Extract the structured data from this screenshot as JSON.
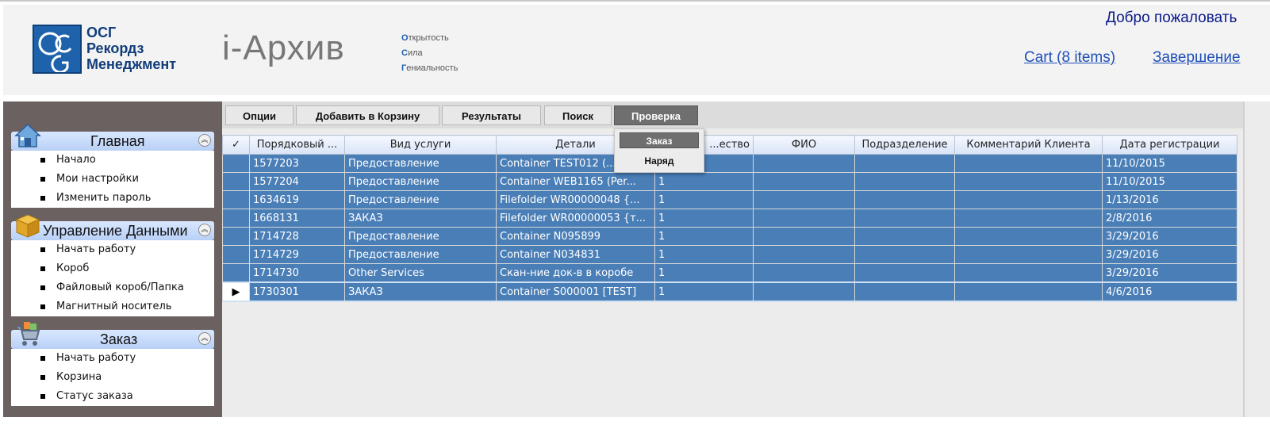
{
  "header": {
    "logo_initials": "OSG",
    "brand_lines": [
      "ОСГ",
      "Рекордз",
      "Менеджмент"
    ],
    "app_title": "i-Архив",
    "motto": [
      {
        "first": "О",
        "rest": "ткрытость"
      },
      {
        "first": "С",
        "rest": "ила"
      },
      {
        "first": "Г",
        "rest": "ениальность"
      }
    ],
    "welcome": "Добро пожаловать",
    "cart_link": "Cart (8 items)",
    "finish_link": "Завершение"
  },
  "sidebar": {
    "panels": [
      {
        "title": "Главная",
        "icon": "house-icon",
        "items": [
          "Начало",
          "Мои настройки",
          "Изменить пароль"
        ]
      },
      {
        "title": "Управление Данными",
        "icon": "box-icon",
        "items": [
          "Начать работу",
          "Короб",
          "Файловый короб/Папка",
          "Магнитный носитель"
        ]
      },
      {
        "title": "Заказ",
        "icon": "shopping-cart-icon",
        "items": [
          "Начать работу",
          "Корзина",
          "Статус заказа"
        ]
      }
    ],
    "collapse_glyph": "︽"
  },
  "toolbar": {
    "buttons": [
      "Опции",
      "Добавить в Корзину",
      "Результаты",
      "Поиск",
      "Проверка"
    ],
    "active": "Проверка"
  },
  "dropdown": {
    "items": [
      "Заказ",
      "Наряд"
    ]
  },
  "grid": {
    "check_header": "✓",
    "columns": [
      "Порядковый ...",
      "Вид услуги",
      "Детали",
      "...ество",
      "ФИО",
      "Подразделение",
      "Комментарий Клиента",
      "Дата регистрации"
    ],
    "current_row_marker": "▶",
    "rows": [
      [
        "1577203",
        "Предоставление",
        "Container TEST012 (...",
        "",
        "",
        "",
        "",
        "11/10/2015"
      ],
      [
        "1577204",
        "Предоставление",
        "Container WEB1165 (Per...",
        "1",
        "",
        "",
        "",
        "11/10/2015"
      ],
      [
        "1634619",
        "Предоставление",
        "Filefolder WR00000048 {...",
        "1",
        "",
        "",
        "",
        "1/13/2016"
      ],
      [
        "1668131",
        "ЗАКАЗ",
        "Filefolder WR00000053 {т...",
        "1",
        "",
        "",
        "",
        "2/8/2016"
      ],
      [
        "1714728",
        "Предоставление",
        "Container N095899",
        "1",
        "",
        "",
        "",
        "3/29/2016"
      ],
      [
        "1714729",
        "Предоставление",
        "Container N034831",
        "1",
        "",
        "",
        "",
        "3/29/2016"
      ],
      [
        "1714730",
        "Other Services",
        "Скан-ние док-в в коробе",
        "1",
        "",
        "",
        "",
        "3/29/2016"
      ],
      [
        "1730301",
        "ЗАКАЗ",
        "Container S000001 [TEST]",
        "1",
        "",
        "",
        "",
        "4/6/2016"
      ]
    ]
  },
  "colors": {
    "row_bg": "#4a7eb7",
    "sidebar_bg": "#6b6160",
    "link": "#1f4fb8",
    "active_button": "#6f6f6f"
  }
}
